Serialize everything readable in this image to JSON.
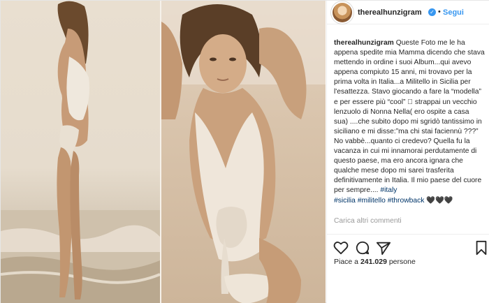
{
  "media": {
    "left_photo": "sepia-beach-photo-full-body",
    "right_photo": "sepia-beach-photo-portrait"
  },
  "header": {
    "username": "therealhunzigram",
    "verified_icon": "verified-badge-icon",
    "separator": "•",
    "follow_label": "Segui"
  },
  "caption": {
    "username": "therealhunzigram",
    "text": " Queste Foto me le ha appena spedite mia Mamma dicendo che stava mettendo in ordine i suoi Album...qui avevo appena compiuto 15 anni, mi trovavo per la prima volta in Italia...a Militello in Sicilia per l'esattezza. Stavo giocando a fare la “modella” e per essere più “cool” 🏻 strappai un vecchio lenzuolo di Nonna Nella( ero ospite a casa sua) ....che subito dopo mi sgridò tantissimo in siciliano e mi disse:”ma chi stai faciennù ???” No vabbè...quanto ci credevo? Quella fu la vacanza in cui mi innamorai perdutamente di questo paese, ma ero ancora ignara che qualche mese dopo mi sarei trasferita definitivamente in Italia. Il mio paese del cuore per sempre.... ",
    "hashtags": [
      "#italy",
      "#sicilia",
      "#militello",
      "#throwback"
    ],
    "hearts": "🖤🖤🖤"
  },
  "comments": {
    "load_more": "Carica altri commenti"
  },
  "actions": {
    "like_icon": "heart-icon",
    "comment_icon": "comment-icon",
    "share_icon": "share-icon",
    "save_icon": "bookmark-icon"
  },
  "likes": {
    "prefix": "Piace a ",
    "count": "241.029",
    "suffix": " persone"
  },
  "colors": {
    "link_blue": "#3897f0",
    "hashtag_blue": "#003569",
    "muted_gray": "#999999",
    "text": "#262626"
  }
}
